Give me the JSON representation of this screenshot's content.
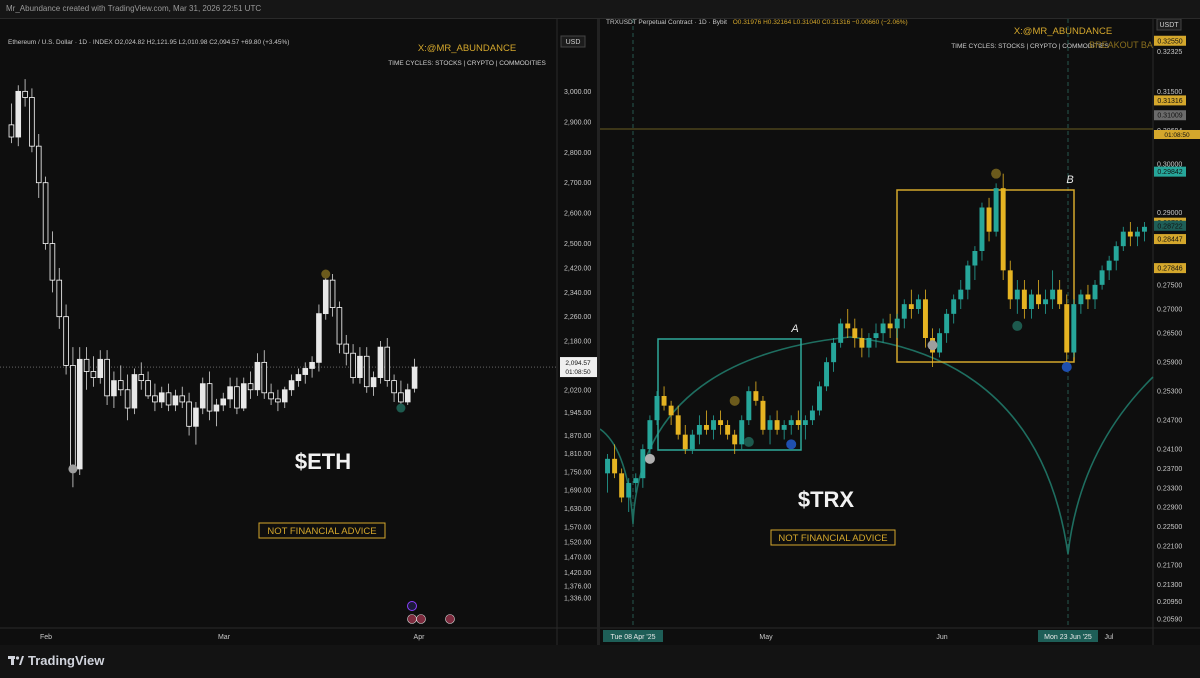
{
  "top_bar": {
    "text": "Mr_Abundance created with TradingView.com, Mar 31, 2026 22:51 UTC"
  },
  "footer": {
    "brand": "TradingView"
  },
  "colors": {
    "bull_eth": "#e8e8e8",
    "bull_trx": "#26a69a",
    "bear_trx": "#e6b422",
    "gold": "#d4a72c",
    "teal": "#2fa89a"
  },
  "left_chart": {
    "legend": "Ethereum / U.S. Dollar · 1D · INDEX  O2,024.82  H2,121.95  L2,010.98  C2,094.57  +69.80 (+3.45%)",
    "watermark_handle": "X:@MR_ABUNDANCE",
    "watermark_sub": "TIME CYCLES: STOCKS | CRYPTO | COMMODITIES",
    "currency": "USD",
    "ticker_label": "$ETH",
    "disclaimer": "NOT FINANCIAL ADVICE",
    "price_tag": "2,094.57",
    "countdown": "01:08:50"
  },
  "right_chart": {
    "legend_pair": "TRXUSDT Perpetual Contract · 1D · Bybit",
    "legend_ohlc": "O0.31976  H0.32164  L0.31040  C0.31316  −0.00660 (−2.06%)",
    "watermark_handle": "X:@MR_ABUNDANCE",
    "watermark_sub": "TIME CYCLES: STOCKS | CRYPTO | COMMODITIES",
    "watermark_overlap": "BREAKOUT BA",
    "currency": "USDT",
    "ticker_label": "$TRX",
    "disclaimer": "NOT FINANCIAL ADVICE",
    "box_label_a": "A",
    "box_label_b": "B",
    "date_tag_1": "Tue 08 Apr '25",
    "date_tag_2": "Mon 23 Jun '25",
    "countdown": "01:08:50"
  },
  "chart_data": [
    {
      "type": "candlestick",
      "title": "Ethereum / U.S. Dollar · 1D · INDEX",
      "x_ticks": [
        "Feb",
        "Mar",
        "Apr"
      ],
      "y_ticks": [
        "3,000.00",
        "2,900.00",
        "2,800.00",
        "2,700.00",
        "2,600.00",
        "2,500.00",
        "2,420.00",
        "2,340.00",
        "2,260.00",
        "2,180.00",
        "2,100.00",
        "2,020.00",
        "1,945.00",
        "1,870.00",
        "1,810.00",
        "1,750.00",
        "1,690.00",
        "1,630.00",
        "1,570.00",
        "1,520.00",
        "1,470.00",
        "1,420.00",
        "1,376.00",
        "1,336.00"
      ],
      "ylim": [
        1300,
        3080
      ],
      "last_price": 2094.57,
      "candles_ohlc": [
        [
          2890,
          2960,
          2830,
          2850
        ],
        [
          2850,
          3020,
          2820,
          3000
        ],
        [
          3000,
          3040,
          2950,
          2980
        ],
        [
          2980,
          3010,
          2800,
          2820
        ],
        [
          2820,
          2860,
          2650,
          2700
        ],
        [
          2700,
          2720,
          2480,
          2500
        ],
        [
          2500,
          2540,
          2340,
          2380
        ],
        [
          2380,
          2420,
          2220,
          2260
        ],
        [
          2260,
          2300,
          2070,
          2100
        ],
        [
          2100,
          2160,
          1700,
          1760
        ],
        [
          1760,
          2160,
          1740,
          2120
        ],
        [
          2120,
          2160,
          2020,
          2080
        ],
        [
          2080,
          2130,
          2030,
          2060
        ],
        [
          2060,
          2150,
          2040,
          2120
        ],
        [
          2120,
          2150,
          1970,
          2000
        ],
        [
          2000,
          2080,
          1960,
          2050
        ],
        [
          2050,
          2100,
          2000,
          2020
        ],
        [
          2020,
          2070,
          1920,
          1960
        ],
        [
          1960,
          2090,
          1940,
          2070
        ],
        [
          2070,
          2110,
          2020,
          2050
        ],
        [
          2050,
          2080,
          1990,
          2000
        ],
        [
          2000,
          2040,
          1950,
          1980
        ],
        [
          1980,
          2030,
          1960,
          2010
        ],
        [
          2010,
          2040,
          1950,
          1970
        ],
        [
          1970,
          2020,
          1950,
          2000
        ],
        [
          2000,
          2030,
          1960,
          1980
        ],
        [
          1980,
          2010,
          1870,
          1900
        ],
        [
          1900,
          1980,
          1840,
          1960
        ],
        [
          1960,
          2060,
          1940,
          2040
        ],
        [
          2040,
          2080,
          1920,
          1950
        ],
        [
          1950,
          1990,
          1900,
          1970
        ],
        [
          1970,
          2010,
          1950,
          1990
        ],
        [
          1990,
          2060,
          1960,
          2030
        ],
        [
          2030,
          2060,
          1940,
          1960
        ],
        [
          1960,
          2060,
          1950,
          2040
        ],
        [
          2040,
          2080,
          1990,
          2020
        ],
        [
          2020,
          2140,
          2000,
          2110
        ],
        [
          2110,
          2150,
          1990,
          2010
        ],
        [
          2010,
          2040,
          1970,
          1990
        ],
        [
          1990,
          2020,
          1950,
          1980
        ],
        [
          1980,
          2030,
          1960,
          2020
        ],
        [
          2020,
          2070,
          2000,
          2050
        ],
        [
          2050,
          2090,
          2030,
          2070
        ],
        [
          2070,
          2110,
          2040,
          2090
        ],
        [
          2090,
          2130,
          2060,
          2110
        ],
        [
          2110,
          2300,
          2080,
          2270
        ],
        [
          2270,
          2400,
          2250,
          2380
        ],
        [
          2380,
          2400,
          2260,
          2290
        ],
        [
          2290,
          2310,
          2140,
          2170
        ],
        [
          2170,
          2200,
          2100,
          2140
        ],
        [
          2140,
          2170,
          2040,
          2060
        ],
        [
          2060,
          2160,
          2040,
          2130
        ],
        [
          2130,
          2160,
          2010,
          2030
        ],
        [
          2030,
          2080,
          2000,
          2060
        ],
        [
          2060,
          2180,
          2040,
          2160
        ],
        [
          2160,
          2190,
          2030,
          2050
        ],
        [
          2050,
          2070,
          1980,
          2010
        ],
        [
          2010,
          2050,
          1960,
          1980
        ],
        [
          1980,
          2040,
          1970,
          2020
        ],
        [
          2024.82,
          2121.95,
          2010.98,
          2094.57
        ]
      ],
      "markers": [
        {
          "candle": 9,
          "price": 1760,
          "color": "#9e9e9e"
        },
        {
          "candle": 46,
          "price": 2400,
          "color": "#6b5a1c"
        },
        {
          "candle": 57,
          "price": 1960,
          "color": "#1d5a4e"
        }
      ]
    },
    {
      "type": "candlestick",
      "title": "TRXUSDT Perpetual Contract · 1D · Bybit",
      "x_ticks": [
        "Tue 08 Apr '25",
        "May",
        "Jun",
        "Mon 23 Jun '25",
        "Jul"
      ],
      "y_ticks": [
        "0.32550",
        "0.32325",
        "0.31500",
        "0.31316",
        "0.31009",
        "0.30694",
        "0.30000",
        "0.29842",
        "0.29839",
        "0.29000",
        "0.28786",
        "0.28722",
        "0.28462",
        "0.28447",
        "0.27846",
        "0.27500",
        "0.27000",
        "0.26500",
        "0.25900",
        "0.25300",
        "0.24700",
        "0.24100",
        "0.23700",
        "0.23300",
        "0.22900",
        "0.22500",
        "0.22100",
        "0.21700",
        "0.21300",
        "0.20950",
        "0.20590"
      ],
      "ylim": [
        0.204,
        0.33
      ],
      "last_price": 0.31316,
      "candles_ohlc": [
        [
          0.236,
          0.24,
          0.232,
          0.239
        ],
        [
          0.239,
          0.242,
          0.235,
          0.236
        ],
        [
          0.236,
          0.237,
          0.23,
          0.231
        ],
        [
          0.231,
          0.235,
          0.228,
          0.234
        ],
        [
          0.234,
          0.236,
          0.232,
          0.235
        ],
        [
          0.235,
          0.242,
          0.233,
          0.241
        ],
        [
          0.241,
          0.248,
          0.24,
          0.247
        ],
        [
          0.247,
          0.253,
          0.246,
          0.252
        ],
        [
          0.252,
          0.254,
          0.249,
          0.25
        ],
        [
          0.25,
          0.251,
          0.246,
          0.248
        ],
        [
          0.248,
          0.25,
          0.243,
          0.244
        ],
        [
          0.244,
          0.246,
          0.24,
          0.241
        ],
        [
          0.241,
          0.245,
          0.24,
          0.244
        ],
        [
          0.244,
          0.248,
          0.242,
          0.246
        ],
        [
          0.246,
          0.249,
          0.244,
          0.245
        ],
        [
          0.245,
          0.248,
          0.243,
          0.247
        ],
        [
          0.247,
          0.249,
          0.244,
          0.246
        ],
        [
          0.246,
          0.247,
          0.243,
          0.244
        ],
        [
          0.244,
          0.245,
          0.24,
          0.242
        ],
        [
          0.242,
          0.248,
          0.241,
          0.247
        ],
        [
          0.247,
          0.254,
          0.246,
          0.253
        ],
        [
          0.253,
          0.255,
          0.25,
          0.251
        ],
        [
          0.251,
          0.252,
          0.244,
          0.245
        ],
        [
          0.245,
          0.248,
          0.242,
          0.247
        ],
        [
          0.247,
          0.249,
          0.244,
          0.245
        ],
        [
          0.245,
          0.247,
          0.243,
          0.246
        ],
        [
          0.246,
          0.248,
          0.244,
          0.247
        ],
        [
          0.247,
          0.249,
          0.245,
          0.246
        ],
        [
          0.246,
          0.248,
          0.243,
          0.247
        ],
        [
          0.247,
          0.25,
          0.246,
          0.249
        ],
        [
          0.249,
          0.255,
          0.248,
          0.254
        ],
        [
          0.254,
          0.26,
          0.253,
          0.259
        ],
        [
          0.259,
          0.264,
          0.257,
          0.263
        ],
        [
          0.263,
          0.268,
          0.262,
          0.267
        ],
        [
          0.267,
          0.27,
          0.264,
          0.266
        ],
        [
          0.266,
          0.268,
          0.262,
          0.264
        ],
        [
          0.264,
          0.266,
          0.26,
          0.262
        ],
        [
          0.262,
          0.265,
          0.26,
          0.264
        ],
        [
          0.264,
          0.267,
          0.262,
          0.265
        ],
        [
          0.265,
          0.268,
          0.263,
          0.267
        ],
        [
          0.267,
          0.269,
          0.264,
          0.266
        ],
        [
          0.266,
          0.269,
          0.264,
          0.268
        ],
        [
          0.268,
          0.272,
          0.266,
          0.271
        ],
        [
          0.271,
          0.274,
          0.268,
          0.27
        ],
        [
          0.27,
          0.273,
          0.269,
          0.272
        ],
        [
          0.272,
          0.274,
          0.262,
          0.264
        ],
        [
          0.264,
          0.266,
          0.258,
          0.261
        ],
        [
          0.261,
          0.266,
          0.26,
          0.265
        ],
        [
          0.265,
          0.27,
          0.263,
          0.269
        ],
        [
          0.269,
          0.273,
          0.267,
          0.272
        ],
        [
          0.272,
          0.276,
          0.27,
          0.274
        ],
        [
          0.274,
          0.28,
          0.272,
          0.279
        ],
        [
          0.279,
          0.283,
          0.276,
          0.282
        ],
        [
          0.282,
          0.292,
          0.28,
          0.291
        ],
        [
          0.291,
          0.293,
          0.284,
          0.286
        ],
        [
          0.286,
          0.296,
          0.285,
          0.295
        ],
        [
          0.295,
          0.298,
          0.276,
          0.278
        ],
        [
          0.278,
          0.28,
          0.27,
          0.272
        ],
        [
          0.272,
          0.276,
          0.269,
          0.274
        ],
        [
          0.274,
          0.276,
          0.268,
          0.27
        ],
        [
          0.27,
          0.274,
          0.268,
          0.273
        ],
        [
          0.273,
          0.276,
          0.27,
          0.271
        ],
        [
          0.271,
          0.274,
          0.269,
          0.272
        ],
        [
          0.272,
          0.278,
          0.27,
          0.274
        ],
        [
          0.274,
          0.276,
          0.27,
          0.271
        ],
        [
          0.271,
          0.273,
          0.259,
          0.261
        ],
        [
          0.261,
          0.272,
          0.26,
          0.271
        ],
        [
          0.271,
          0.274,
          0.269,
          0.273
        ],
        [
          0.273,
          0.275,
          0.27,
          0.272
        ],
        [
          0.272,
          0.276,
          0.27,
          0.275
        ],
        [
          0.275,
          0.279,
          0.274,
          0.278
        ],
        [
          0.278,
          0.281,
          0.276,
          0.28
        ],
        [
          0.28,
          0.284,
          0.278,
          0.283
        ],
        [
          0.283,
          0.287,
          0.282,
          0.286
        ],
        [
          0.286,
          0.288,
          0.283,
          0.285
        ],
        [
          0.285,
          0.287,
          0.283,
          0.286
        ],
        [
          0.286,
          0.288,
          0.284,
          0.287
        ]
      ],
      "markers": [
        {
          "candle": 6,
          "price": 0.239,
          "color": "#b0b0b0"
        },
        {
          "candle": 18,
          "price": 0.251,
          "color": "#6b5a1c"
        },
        {
          "candle": 20,
          "price": 0.2425,
          "color": "#1d5a4e"
        },
        {
          "candle": 26,
          "price": 0.242,
          "color": "#1f4fb0"
        },
        {
          "candle": 46,
          "price": 0.2625,
          "color": "#9e9e9e"
        },
        {
          "candle": 55,
          "price": 0.298,
          "color": "#6b5a1c"
        },
        {
          "candle": 58,
          "price": 0.2665,
          "color": "#1d5a4e"
        },
        {
          "candle": 65,
          "price": 0.258,
          "color": "#1f4fb0"
        }
      ],
      "price_tags": [
        {
          "value": "0.32550",
          "bg": "#d4a72c"
        },
        {
          "value": "0.31316",
          "bg": "#d4a72c"
        },
        {
          "value": "0.31009",
          "bg": "#6b6b6b"
        },
        {
          "value": "0.29842",
          "bg": "#26a69a"
        },
        {
          "value": "0.28786",
          "bg": "#d4a72c"
        },
        {
          "value": "0.28722",
          "bg": "#1e5e57"
        },
        {
          "value": "0.28447",
          "bg": "#d4a72c"
        },
        {
          "value": "0.27846",
          "bg": "#d4a72c"
        }
      ]
    }
  ]
}
